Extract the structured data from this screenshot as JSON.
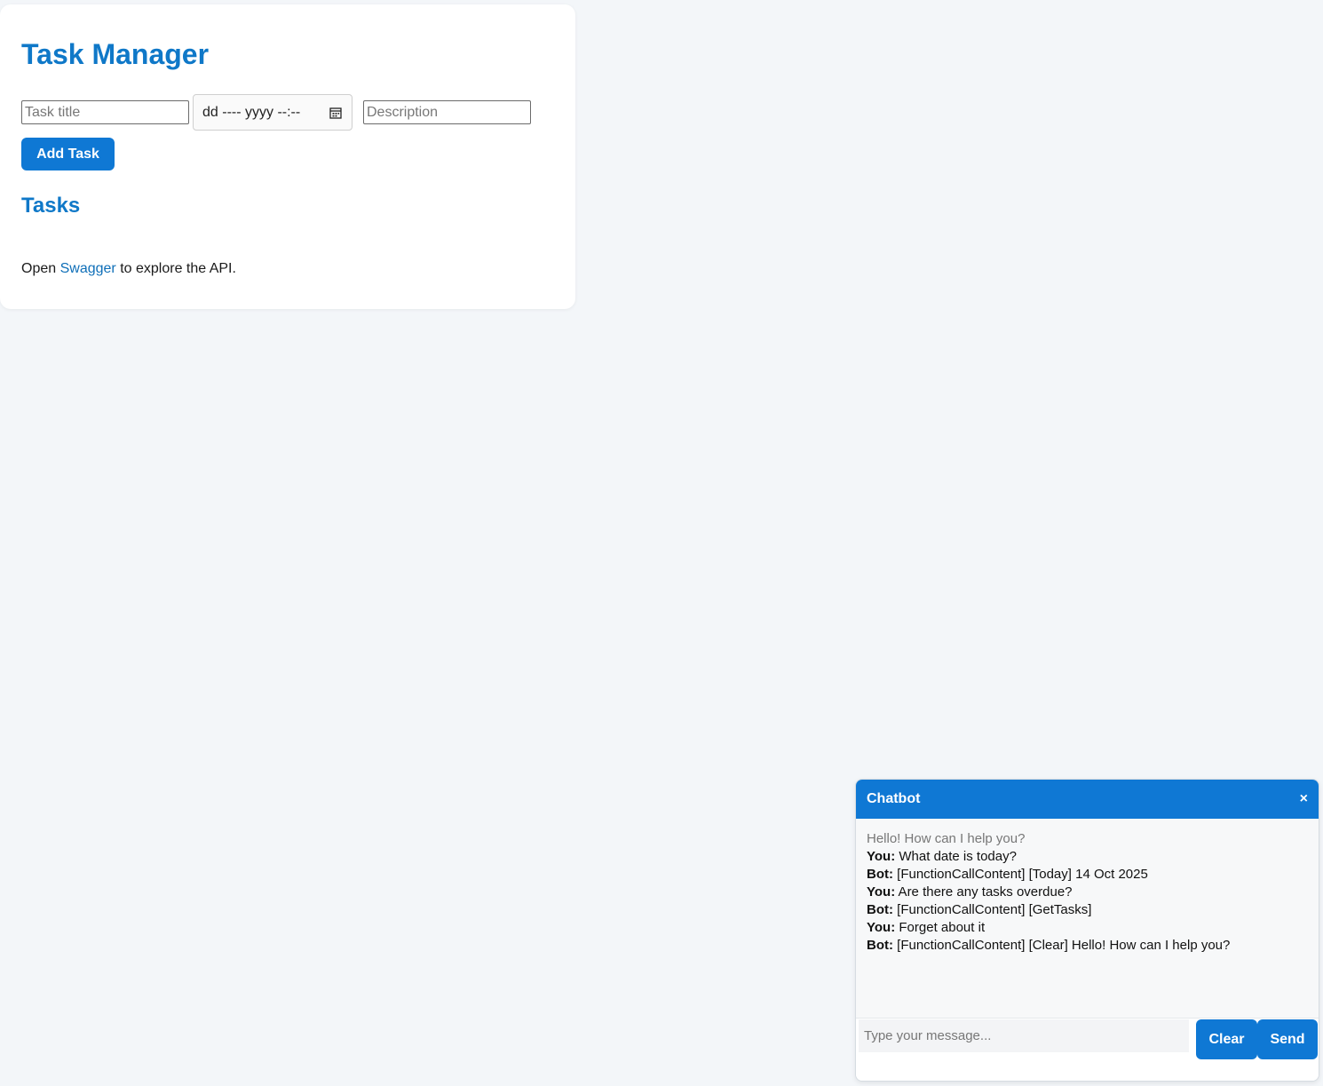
{
  "app": {
    "title": "Task Manager"
  },
  "form": {
    "title_placeholder": "Task title",
    "date_placeholder": "dd ---- yyyy --:--",
    "description_placeholder": "Description",
    "add_label": "Add Task",
    "calendar_icon": "calendar-icon"
  },
  "tasks": {
    "heading": "Tasks",
    "items": []
  },
  "footer": {
    "prefix": "Open ",
    "link_text": "Swagger",
    "suffix": " to explore the API."
  },
  "chat": {
    "title": "Chatbot",
    "close_label": "×",
    "greeting": "Hello! How can I help you?",
    "messages": [
      {
        "speaker": "You:",
        "text": " What date is today?"
      },
      {
        "speaker": "Bot:",
        "text": " [FunctionCallContent] [Today] 14 Oct 2025"
      },
      {
        "speaker": "You:",
        "text": " Are there any tasks overdue?"
      },
      {
        "speaker": "Bot:",
        "text": " [FunctionCallContent] [GetTasks]"
      },
      {
        "speaker": "You:",
        "text": " Forget about it"
      },
      {
        "speaker": "Bot:",
        "text": " [FunctionCallContent] [Clear] Hello! How can I help you?"
      }
    ],
    "input_placeholder": "Type your message...",
    "clear_label": "Clear",
    "send_label": "Send"
  },
  "colors": {
    "accent": "#0f78d4",
    "heading": "#0f78c8",
    "background": "#f3f6f9"
  }
}
